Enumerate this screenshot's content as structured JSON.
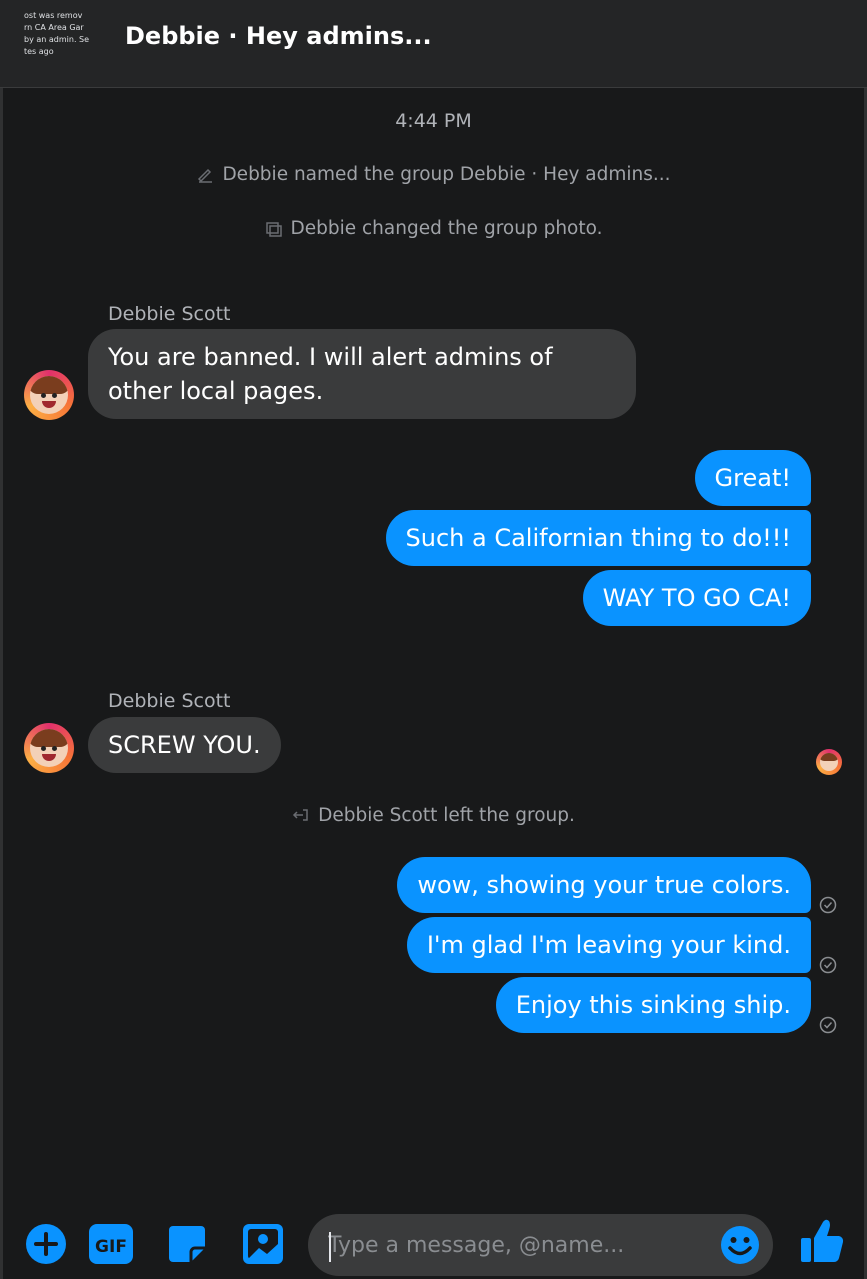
{
  "header": {
    "title": "Debbie · Hey admins...",
    "group_photo_lines": [
      "ost was remov",
      "rn CA Area Gar",
      "by an admin. Se",
      "tes ago"
    ]
  },
  "conversation": {
    "timestamp": "4:44 PM",
    "events": {
      "renamed": "Debbie named the group Debbie · Hey admins...",
      "photo_changed": "Debbie changed the group photo.",
      "left": "Debbie Scott left the group."
    },
    "messages": [
      {
        "sender": "Debbie Scott",
        "direction": "incoming",
        "text": "You are banned. I will alert admins of other local pages."
      },
      {
        "direction": "outgoing",
        "text": "Great!"
      },
      {
        "direction": "outgoing",
        "text": "Such a Californian thing to do!!!"
      },
      {
        "direction": "outgoing",
        "text": "WAY TO GO CA!"
      },
      {
        "sender": "Debbie Scott",
        "direction": "incoming",
        "text": "SCREW YOU."
      },
      {
        "direction": "outgoing",
        "text": "wow, showing your true colors."
      },
      {
        "direction": "outgoing",
        "text": "I'm glad I'm leaving your kind."
      },
      {
        "direction": "outgoing",
        "text": "Enjoy this sinking ship."
      }
    ]
  },
  "composer": {
    "placeholder": "Type a message, @name...",
    "gif_label": "GIF"
  },
  "colors": {
    "background": "#18191a",
    "incoming_bubble": "#3a3b3c",
    "outgoing_bubble": "#0a93ff",
    "accent": "#0a93ff"
  },
  "icons": [
    "plus-icon",
    "gif-icon",
    "sticker-icon",
    "image-icon",
    "emoji-icon",
    "thumbs-up-icon",
    "pencil-icon",
    "photo-change-icon",
    "leave-icon",
    "sent-check-icon"
  ]
}
